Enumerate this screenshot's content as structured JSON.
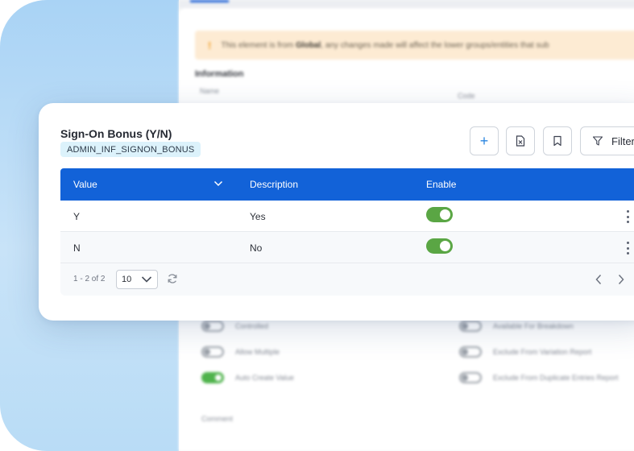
{
  "background_page": {
    "warning_text_prefix": "This element is from",
    "warning_text_bold": "Global",
    "warning_text_suffix": ", any changes made will affect the lower groups/entities that sub",
    "section_title": "Information",
    "name_label": "Name",
    "code_label": "Code",
    "options_left": [
      {
        "label": "Controlled",
        "on": false
      },
      {
        "label": "Allow Multiple",
        "on": false
      },
      {
        "label": "Auto Create Value",
        "on": true
      }
    ],
    "options_right": [
      {
        "label": "Available For Breakdown",
        "on": false
      },
      {
        "label": "Exclude From Variation Report",
        "on": false
      },
      {
        "label": "Exclude From Duplicate Entries Report",
        "on": false
      }
    ],
    "comment_label": "Comment"
  },
  "dialog": {
    "title": "Sign-On Bonus (Y/N)",
    "code": "ADMIN_INF_SIGNON_BONUS",
    "toolbar": {
      "add_label": "+",
      "filter_label": "Filter"
    },
    "table": {
      "columns": {
        "value": "Value",
        "description": "Description",
        "enable": "Enable"
      },
      "rows": [
        {
          "value": "Y",
          "description": "Yes",
          "enabled": true
        },
        {
          "value": "N",
          "description": "No",
          "enabled": true
        }
      ]
    },
    "pagination": {
      "range_text": "1 - 2 of 2",
      "page_size": "10"
    }
  },
  "colors": {
    "header_blue": "#1262d8",
    "toggle_green": "#5aa644",
    "code_chip_bg": "#dcf2fb",
    "backdrop_blue": "#a9d3f5"
  }
}
